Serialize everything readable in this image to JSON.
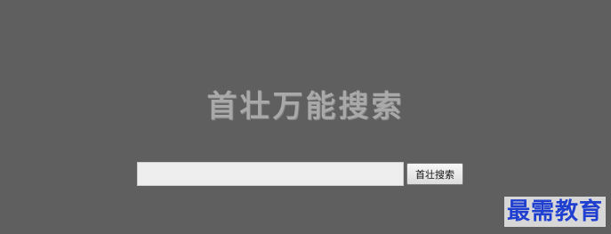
{
  "logo": {
    "text": "首壮万能搜索"
  },
  "search": {
    "value": "",
    "placeholder": "",
    "button_label": "首壮搜索"
  },
  "watermark": {
    "text": "最需教育"
  },
  "colors": {
    "background": "#5f5f5f",
    "logo_text": "#a9a9a9",
    "input_background": "#eeeeee",
    "watermark_text": "#1f3fd1"
  }
}
